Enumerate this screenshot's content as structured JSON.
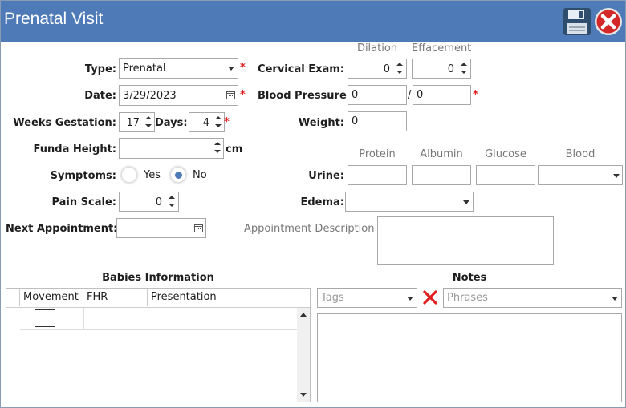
{
  "window": {
    "title": "Prenatal Visit"
  },
  "toolbar": {
    "save_icon": "floppy-disk-icon",
    "close_icon": "red-close-icon"
  },
  "form": {
    "type": {
      "label": "Type:",
      "value": "Prenatal"
    },
    "date": {
      "label": "Date:",
      "value": "3/29/2023"
    },
    "weeks_gestation": {
      "label": "Weeks Gestation:",
      "value": "17"
    },
    "days": {
      "label": "Days:",
      "value": "4"
    },
    "funda_height": {
      "label": "Funda Height:",
      "value": "",
      "unit": "cm"
    },
    "symptoms": {
      "label": "Symptoms:",
      "yes": "Yes",
      "no": "No",
      "selected": "No"
    },
    "pain_scale": {
      "label": "Pain Scale:",
      "value": "0"
    },
    "next_appointment": {
      "label": "Next Appointment:",
      "value": ""
    },
    "cervical_exam": {
      "label": "Cervical Exam:",
      "dilation_header": "Dilation",
      "effacement_header": "Effacement",
      "dilation": "0",
      "effacement": "0"
    },
    "blood_pressure": {
      "label": "Blood Pressure:",
      "systolic": "0",
      "separator": "/",
      "diastolic": "0"
    },
    "weight": {
      "label": "Weight:",
      "value": "0"
    },
    "urine": {
      "label": "Urine:",
      "headers": [
        "Protein",
        "Albumin",
        "Glucose",
        "Blood"
      ],
      "protein": "",
      "albumin": "",
      "glucose": "",
      "blood": ""
    },
    "edema": {
      "label": "Edema:",
      "value": ""
    },
    "appointment_description": {
      "label": "Appointment Description",
      "value": ""
    },
    "required_mark": "*"
  },
  "babies": {
    "title": "Babies Information",
    "columns": [
      "Movement",
      "FHR",
      "Presentation"
    ]
  },
  "notes": {
    "title": "Notes",
    "tags_placeholder": "Tags",
    "phrases_placeholder": "Phrases",
    "text": ""
  },
  "colors": {
    "titlebar": "#4e7ab8",
    "required": "#e02020",
    "radio_selected": "#4e7ab8"
  }
}
